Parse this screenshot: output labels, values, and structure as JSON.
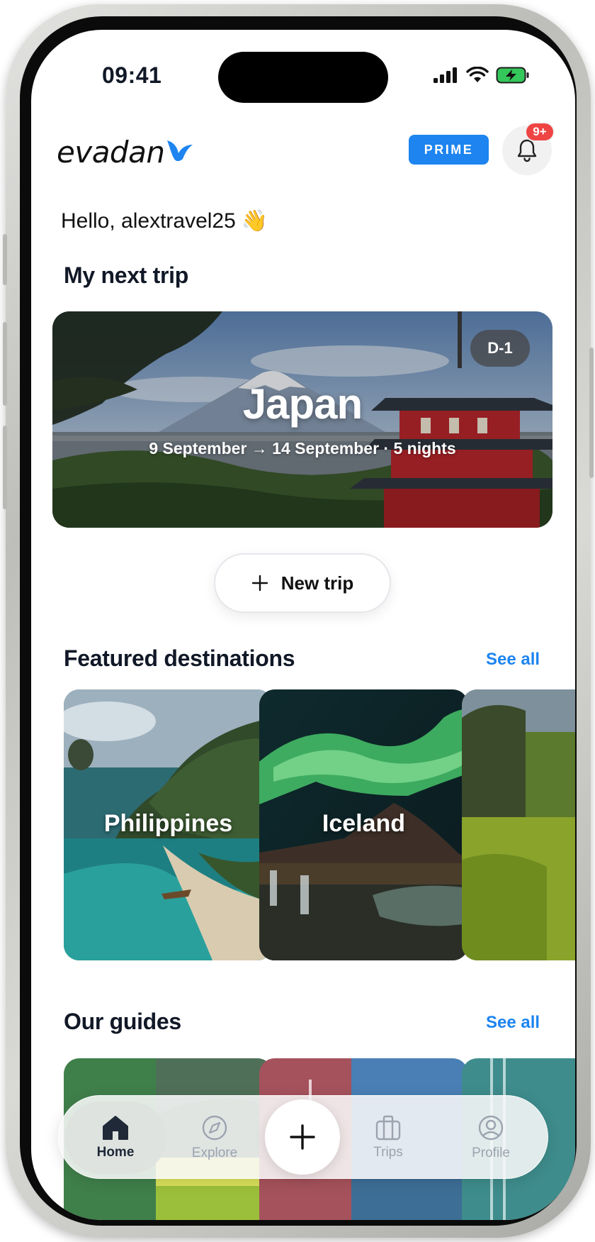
{
  "status_bar": {
    "time": "09:41"
  },
  "header": {
    "logo_text": "evadan",
    "prime_label": "PRIME",
    "notification_count": "9+"
  },
  "greeting": {
    "text": "Hello, alextravel25",
    "emoji": "👋"
  },
  "next_trip": {
    "section_title": "My next trip",
    "destination": "Japan",
    "dates": "9 September → 14 September · 5 nights",
    "countdown": "D-1"
  },
  "new_trip_button": {
    "icon": "plus-icon",
    "label": "New trip"
  },
  "featured": {
    "section_title": "Featured destinations",
    "see_all": "See all",
    "items": [
      {
        "name": "Philippines"
      },
      {
        "name": "Iceland"
      },
      {
        "name": ""
      }
    ]
  },
  "guides": {
    "section_title": "Our guides",
    "see_all": "See all"
  },
  "bottom_nav": {
    "items": [
      {
        "label": "Home",
        "icon": "home-icon",
        "active": true
      },
      {
        "label": "Explore",
        "icon": "compass-icon",
        "active": false
      },
      {
        "label": "Trips",
        "icon": "suitcase-icon",
        "active": false
      },
      {
        "label": "Profile",
        "icon": "user-circle-icon",
        "active": false
      }
    ],
    "add_icon": "plus-icon"
  },
  "colors": {
    "accent": "#1d84f0",
    "badge": "#ef4444",
    "text": "#111827"
  }
}
